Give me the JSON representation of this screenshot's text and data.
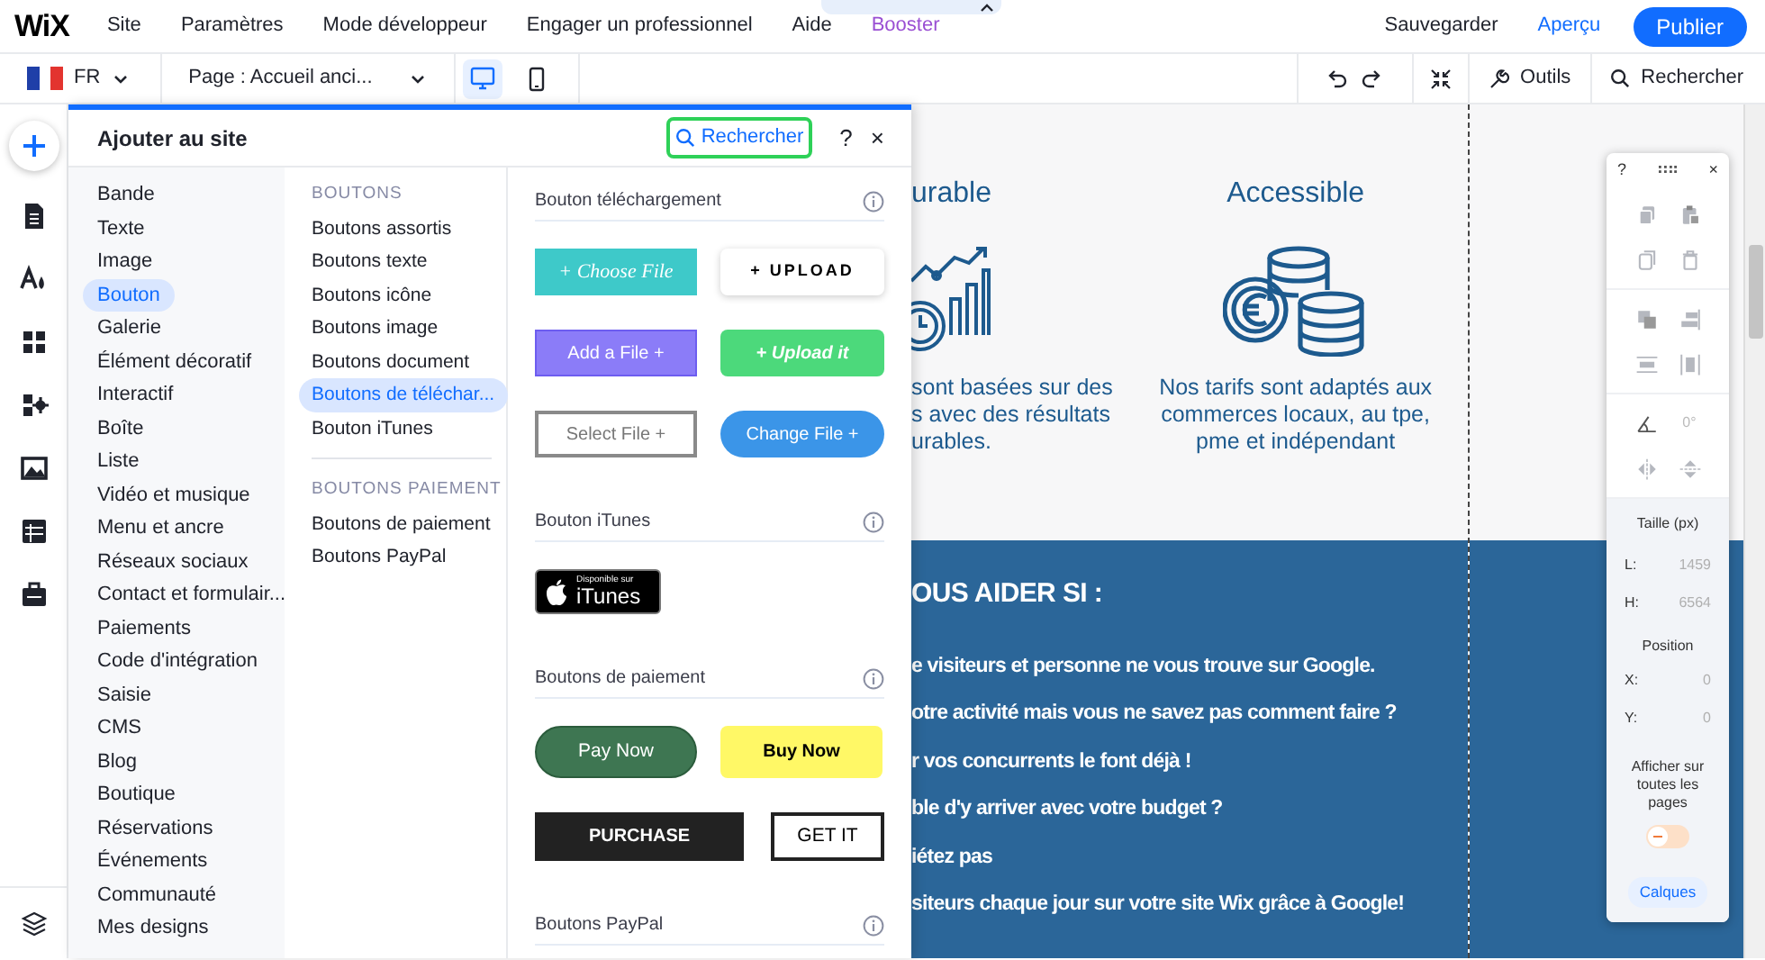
{
  "top_bar": {
    "logo": "WiX",
    "menu": [
      {
        "label": "Site",
        "kind": "plain"
      },
      {
        "label": "Paramètres",
        "kind": "plain"
      },
      {
        "label": "Mode développeur",
        "kind": "plain"
      },
      {
        "label": "Engager un professionnel",
        "kind": "plain"
      },
      {
        "label": "Aide",
        "kind": "plain"
      },
      {
        "label": "Booster",
        "kind": "promo"
      }
    ],
    "save": "Sauvegarder",
    "preview": "Aperçu",
    "publish": "Publier"
  },
  "toolbar": {
    "language": "FR",
    "page": "Page : Accueil anci...",
    "devices": [
      {
        "kind": "desktop",
        "selected": true
      },
      {
        "kind": "mobile",
        "selected": false
      }
    ],
    "tools": "Outils",
    "search": "Rechercher"
  },
  "rail": [
    {
      "kind": "add"
    },
    {
      "kind": "pages"
    },
    {
      "kind": "design"
    },
    {
      "kind": "apps"
    },
    {
      "kind": "app-market"
    },
    {
      "kind": "media"
    },
    {
      "kind": "cms"
    },
    {
      "kind": "business"
    },
    {
      "kind": "layers"
    }
  ],
  "panel": {
    "title": "Ajouter au site",
    "search": "Rechercher",
    "search_highlighted": true,
    "help": "?",
    "close": "×",
    "categories": [
      {
        "label": "Bande",
        "selected": false
      },
      {
        "label": "Texte",
        "selected": false
      },
      {
        "label": "Image",
        "selected": false
      },
      {
        "label": "Bouton",
        "selected": true
      },
      {
        "label": "Galerie",
        "selected": false
      },
      {
        "label": "Élément décoratif",
        "selected": false
      },
      {
        "label": "Interactif",
        "selected": false
      },
      {
        "label": "Boîte",
        "selected": false
      },
      {
        "label": "Liste",
        "selected": false
      },
      {
        "label": "Vidéo et musique",
        "selected": false
      },
      {
        "label": "Menu et ancre",
        "selected": false
      },
      {
        "label": "Réseaux sociaux",
        "selected": false
      },
      {
        "label": "Contact et formulair...",
        "selected": false
      },
      {
        "label": "Paiements",
        "selected": false
      },
      {
        "label": "Code d'intégration",
        "selected": false
      },
      {
        "label": "Saisie",
        "selected": false
      },
      {
        "label": "CMS",
        "selected": false
      },
      {
        "label": "Blog",
        "selected": false
      },
      {
        "label": "Boutique",
        "selected": false
      },
      {
        "label": "Réservations",
        "selected": false
      },
      {
        "label": "Événements",
        "selected": false
      },
      {
        "label": "Communauté",
        "selected": false
      },
      {
        "label": "Mes designs",
        "selected": false
      }
    ],
    "subcategory_groups": [
      {
        "heading": "BOUTONS",
        "items": [
          {
            "label": "Boutons assortis",
            "selected": false
          },
          {
            "label": "Boutons texte",
            "selected": false
          },
          {
            "label": "Boutons icône",
            "selected": false
          },
          {
            "label": "Boutons image",
            "selected": false
          },
          {
            "label": "Boutons document",
            "selected": false
          },
          {
            "label": "Boutons de téléchar...",
            "selected": true
          },
          {
            "label": "Bouton iTunes",
            "selected": false
          }
        ]
      },
      {
        "heading": "BOUTONS PAIEMENT",
        "items": [
          {
            "label": "Boutons de paiement",
            "selected": false
          },
          {
            "label": "Boutons PayPal",
            "selected": false
          }
        ]
      }
    ],
    "sections": [
      {
        "title": "Bouton téléchargement",
        "items": [
          {
            "kind": "teal",
            "label": "+ Choose File"
          },
          {
            "kind": "white-shadow",
            "label": "+ UPLOAD"
          },
          {
            "kind": "violet",
            "label": "Add a File +"
          },
          {
            "kind": "green",
            "label": "+ Upload it"
          },
          {
            "kind": "outline-grey",
            "label": "Select File +"
          },
          {
            "kind": "blue-pill",
            "label": "Change File +"
          }
        ]
      },
      {
        "title": "Bouton iTunes",
        "items": [
          {
            "kind": "itunes",
            "caption": "Disponible sur",
            "label": "iTunes"
          }
        ]
      },
      {
        "title": "Boutons de paiement",
        "items": [
          {
            "kind": "green-pill",
            "label": "Pay Now"
          },
          {
            "kind": "yellow",
            "label": "Buy Now"
          },
          {
            "kind": "black",
            "label": "PURCHASE"
          },
          {
            "kind": "outline-black",
            "label": "GET IT"
          }
        ]
      },
      {
        "title": "Boutons PayPal"
      }
    ]
  },
  "canvas": {
    "features": [
      {
        "kind": "chart",
        "title": "urable",
        "lines": [
          "sont basées sur des",
          "s avec des résultats",
          "urables."
        ]
      },
      {
        "kind": "coins",
        "title": "Accessible",
        "lines": [
          "Nos tarifs sont adaptés aux",
          "commerces locaux, au tpe,",
          "pme et indépendant"
        ]
      }
    ],
    "band": {
      "heading": "OUS AIDER SI :",
      "lines": [
        "e visiteurs et personne ne vous trouve sur Google.",
        "otre activité mais vous ne savez pas comment faire ?",
        "r vos concurrents le font déjà !",
        "ble d'y arriver avec votre budget ?",
        "iétez pas",
        "siteurs chaque jour sur votre site Wix grâce à Google!"
      ]
    }
  },
  "properties_panel": {
    "help": "?",
    "close": "×",
    "tool_groups": [
      [
        {
          "kind": "copy"
        },
        {
          "kind": "paste"
        },
        {
          "kind": "duplicate"
        },
        {
          "kind": "delete"
        }
      ],
      [
        {
          "kind": "arrange"
        },
        {
          "kind": "align"
        },
        {
          "kind": "distribute"
        },
        {
          "kind": "match-size"
        }
      ],
      [
        {
          "kind": "rotate"
        },
        {
          "kind": "angle",
          "label": "0°"
        },
        {
          "kind": "flip-h"
        },
        {
          "kind": "flip-v"
        }
      ]
    ],
    "size_title": "Taille (px)",
    "size": [
      {
        "label": "L:",
        "value": "1459"
      },
      {
        "label": "H:",
        "value": "6564"
      }
    ],
    "position_title": "Position",
    "position": [
      {
        "label": "X:",
        "value": "0"
      },
      {
        "label": "Y:",
        "value": "0"
      }
    ],
    "show_all_pages": {
      "label": "Afficher sur toutes les pages",
      "on": false
    },
    "layers": "Calques"
  }
}
